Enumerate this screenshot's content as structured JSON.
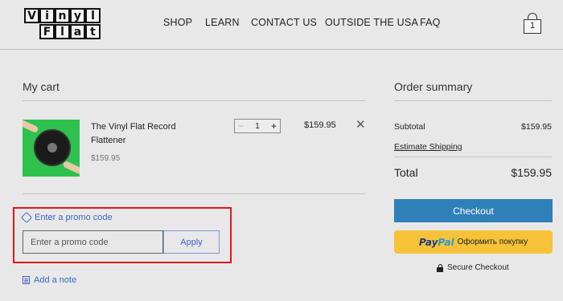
{
  "header": {
    "logo": {
      "row1": [
        "V",
        "i",
        "n",
        "y",
        "l"
      ],
      "row2": [
        "",
        "F",
        "l",
        "a",
        "t"
      ]
    },
    "nav": [
      "SHOP",
      "LEARN",
      "CONTACT US",
      "OUTSIDE THE USA",
      "FAQ"
    ],
    "cart_count": "1"
  },
  "cart": {
    "title": "My cart",
    "item": {
      "name": "The Vinyl Flat Record Flattener",
      "unit_price": "$159.95",
      "quantity": "1",
      "line_price": "$159.95"
    },
    "promo_link": "Enter a promo code",
    "promo_placeholder": "Enter a promo code",
    "apply_label": "Apply",
    "note_link": "Add a note"
  },
  "summary": {
    "title": "Order summary",
    "subtotal_label": "Subtotal",
    "subtotal_value": "$159.95",
    "estimate_shipping": "Estimate Shipping",
    "total_label": "Total",
    "total_value": "$159.95",
    "checkout_label": "Checkout",
    "paypal": {
      "pay": "Pay",
      "pal": "Pal",
      "label": "Оформить покупку"
    },
    "secure_label": "Secure Checkout"
  },
  "colors": {
    "accent_blue": "#2f80b8",
    "link_blue": "#3a66c4",
    "paypal_yellow": "#f6c338",
    "highlight_red": "#e4141b"
  }
}
